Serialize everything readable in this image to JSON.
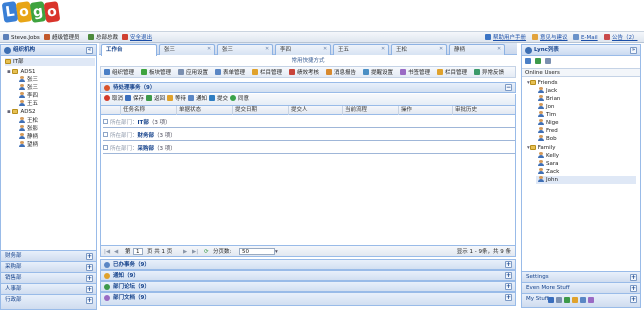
{
  "header": {
    "logo_letters": [
      "L",
      "o",
      "g",
      "o"
    ],
    "logo_colors": [
      "#3a7fd5",
      "#e8a516",
      "#3fa33f",
      "#d9342b"
    ]
  },
  "userbar": {
    "user_name": "Steve.Jobs",
    "role": "超级管理员",
    "overview": "总部总裁",
    "logout": "安全退出",
    "help": "帮助用户手册",
    "feedback": "意见与建议",
    "email": "E-Mail",
    "notice": "公告（2）"
  },
  "left": {
    "title": "组织机构",
    "tree_root": "IT部",
    "ads1": "ADS1",
    "ads1_members": [
      "张三",
      "张三",
      "李四",
      "王五"
    ],
    "ads2": "ADS2",
    "ads2_members": [
      "王松",
      "张影",
      "静柄",
      "望柄"
    ],
    "accordions": [
      "财务部",
      "采购部",
      "销售部",
      "人事部",
      "行政部"
    ]
  },
  "tabs": [
    "工作台",
    "张三",
    "张三",
    "李四",
    "王五",
    "王松",
    "静柄"
  ],
  "quick": {
    "title": "常用快捷方式",
    "buttons": [
      "组织管理",
      "板块管理",
      "应用设置",
      "表单管理",
      "栏目管理",
      "绩效考核",
      "消息报告",
      "提醒设置",
      "书签管理",
      "栏目管理",
      "异常反馈"
    ]
  },
  "pending": {
    "title": "待处理事务",
    "count": "（9）",
    "toolbar": [
      "取消",
      "保存",
      "返回",
      "等待",
      "通知",
      "提交",
      "同意"
    ],
    "columns": [
      "任务名称",
      "单据状态",
      "提交日期",
      "提交人",
      "当前流程",
      "操作",
      "审批历史"
    ],
    "groups": [
      {
        "prefix": "所在部门：",
        "name": "IT部",
        "count": "（3 项）"
      },
      {
        "prefix": "所在部门：",
        "name": "财务部",
        "count": "（3 项）"
      },
      {
        "prefix": "所在部门：",
        "name": "采购部",
        "count": "（3 项）"
      }
    ]
  },
  "pager": {
    "page_prefix": "第",
    "page_value": "1",
    "page_suffix": "页 共 1 页",
    "page_size_label": "分页数:",
    "page_size": "50",
    "summary": "显示 1 - 9条，共 9 条"
  },
  "sections": [
    {
      "title": "已办事务",
      "count": "（9）"
    },
    {
      "title": "通知",
      "count": "（9）"
    },
    {
      "title": "部门论坛",
      "count": "（9）"
    },
    {
      "title": "部门文档",
      "count": "（9）"
    }
  ],
  "right": {
    "title": "Lync列表",
    "online_label": "Online Users",
    "friends_label": "Friends",
    "friends": [
      "Jack",
      "Brian",
      "Jon",
      "Tim",
      "Nige",
      "Fred",
      "Bob"
    ],
    "family_label": "Family",
    "family": [
      "Kelly",
      "Sara",
      "Zack",
      "John"
    ],
    "bottom": [
      "Settings",
      "Even More Stuff",
      "My Stuff"
    ]
  }
}
